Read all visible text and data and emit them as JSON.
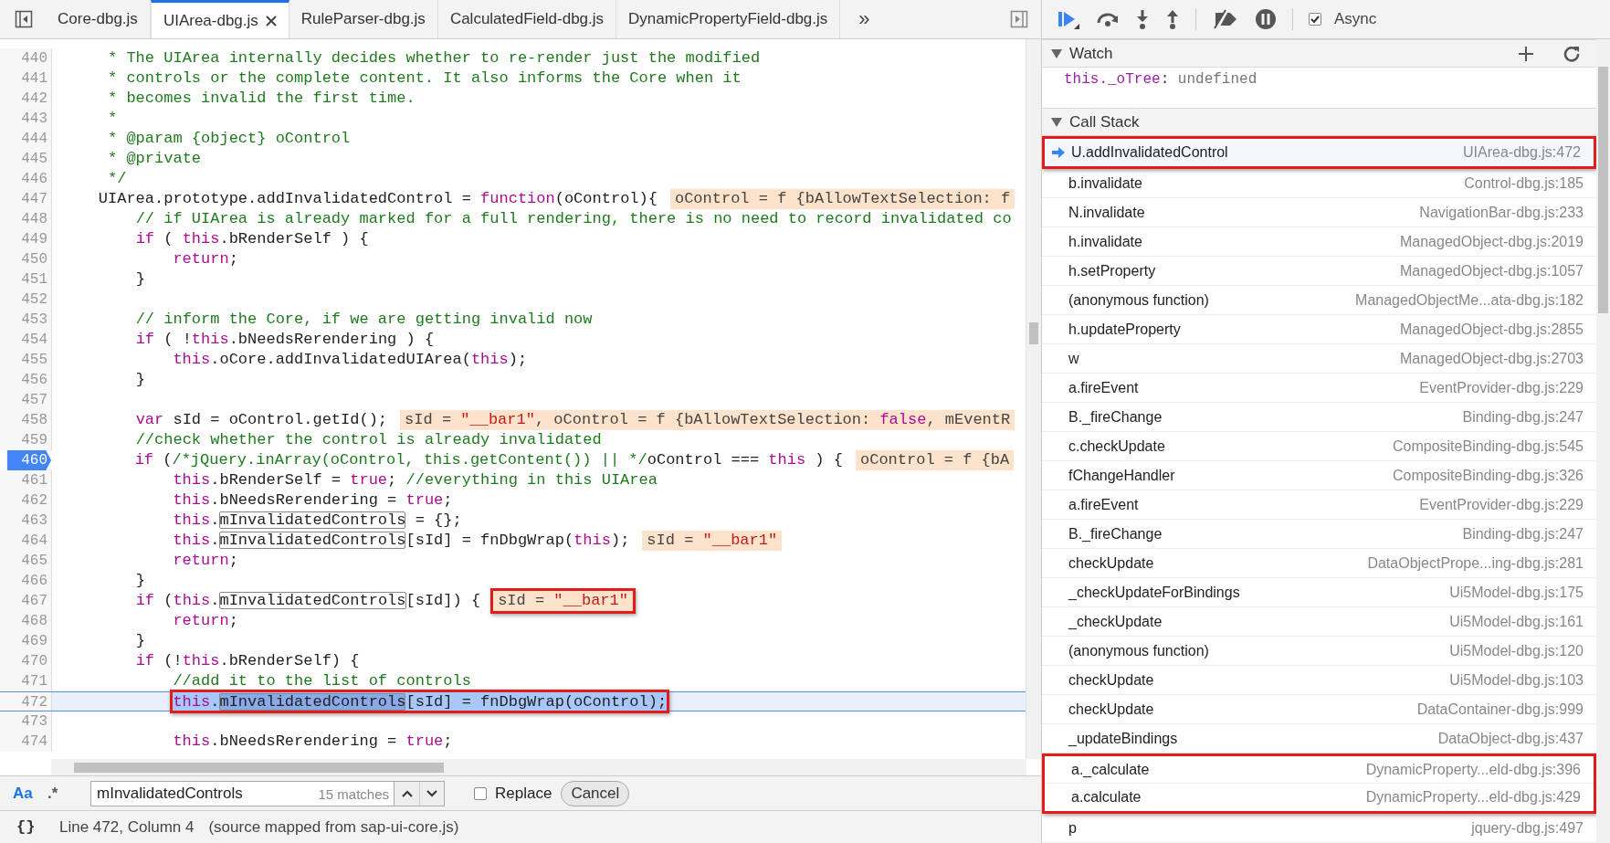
{
  "editor": {
    "tabs": [
      {
        "label": "Core-dbg.js",
        "selected": false
      },
      {
        "label": "UIArea-dbg.js",
        "selected": true
      },
      {
        "label": "RuleParser-dbg.js",
        "selected": false
      },
      {
        "label": "CalculatedField-dbg.js",
        "selected": false
      },
      {
        "label": "DynamicPropertyField-dbg.js",
        "selected": false
      }
    ],
    "more_tabs": "»",
    "lines": [
      {
        "number": "440",
        "breakpoint": false,
        "current": false,
        "code": [
          {
            "kind": "comment",
            "text": "     * The UIArea internally decides whether to re-render just the modified"
          }
        ]
      },
      {
        "number": "441",
        "breakpoint": false,
        "current": false,
        "code": [
          {
            "kind": "comment",
            "text": "     * controls or the complete content. It also informs the Core when it"
          }
        ]
      },
      {
        "number": "442",
        "breakpoint": false,
        "current": false,
        "code": [
          {
            "kind": "comment",
            "text": "     * becomes invalid the first time."
          }
        ]
      },
      {
        "number": "443",
        "breakpoint": false,
        "current": false,
        "code": [
          {
            "kind": "comment",
            "text": "     *"
          }
        ]
      },
      {
        "number": "444",
        "breakpoint": false,
        "current": false,
        "code": [
          {
            "kind": "comment",
            "text": "     * @param {object} oControl"
          }
        ]
      },
      {
        "number": "445",
        "breakpoint": false,
        "current": false,
        "code": [
          {
            "kind": "comment",
            "text": "     * @private"
          }
        ]
      },
      {
        "number": "446",
        "breakpoint": false,
        "current": false,
        "code": [
          {
            "kind": "comment",
            "text": "     */"
          }
        ]
      },
      {
        "number": "447",
        "breakpoint": false,
        "current": false,
        "code": [
          "    UIArea.prototype.addInvalidatedControl = ",
          {
            "kind": "keyword",
            "text": "function"
          },
          "(oControl){"
        ],
        "value": [
          "oControl = f {bAllowTextSelection: f"
        ]
      },
      {
        "number": "448",
        "breakpoint": false,
        "current": false,
        "code": [
          {
            "kind": "comment",
            "text": "        // if UIArea is already marked for a full rendering, there is no need to record invalidated co"
          }
        ]
      },
      {
        "number": "449",
        "breakpoint": false,
        "current": false,
        "code": [
          {
            "kind": "keyword",
            "text": "        if"
          },
          " ( ",
          {
            "kind": "keyword",
            "text": "this"
          },
          ".bRenderSelf ) {"
        ]
      },
      {
        "number": "450",
        "breakpoint": false,
        "current": false,
        "code": [
          {
            "kind": "keyword",
            "text": "            return"
          },
          ";"
        ]
      },
      {
        "number": "451",
        "breakpoint": false,
        "current": false,
        "code": [
          "        }"
        ]
      },
      {
        "number": "452",
        "breakpoint": false,
        "current": false
      },
      {
        "number": "453",
        "breakpoint": false,
        "current": false,
        "code": [
          {
            "kind": "comment",
            "text": "        // inform the Core, if we are getting invalid now"
          }
        ]
      },
      {
        "number": "454",
        "breakpoint": false,
        "current": false,
        "code": [
          {
            "kind": "keyword",
            "text": "        if"
          },
          " ( !",
          {
            "kind": "keyword",
            "text": "this"
          },
          ".bNeedsRerendering ) {"
        ]
      },
      {
        "number": "455",
        "breakpoint": false,
        "current": false,
        "code": [
          {
            "kind": "keyword",
            "text": "            this"
          },
          ".oCore.addInvalidatedUIArea(",
          {
            "kind": "keyword",
            "text": "this"
          },
          ");"
        ]
      },
      {
        "number": "456",
        "breakpoint": false,
        "current": false,
        "code": [
          "        }"
        ]
      },
      {
        "number": "457",
        "breakpoint": false,
        "current": false
      },
      {
        "number": "458",
        "breakpoint": false,
        "current": false,
        "code": [
          {
            "kind": "keyword",
            "text": "        var"
          },
          " sId = oControl.getId();"
        ],
        "value": [
          "sId = ",
          {
            "kind": "string",
            "text": "\"__bar1\""
          },
          ", oControl = f {bAllowTextSelection: ",
          {
            "kind": "keyword",
            "text": "false"
          },
          ", mEventR"
        ]
      },
      {
        "number": "459",
        "breakpoint": false,
        "current": false,
        "code": [
          {
            "kind": "comment",
            "text": "        //check whether the control is already invalidated"
          }
        ]
      },
      {
        "number": "460",
        "breakpoint": true,
        "current": false,
        "code": [
          {
            "kind": "keyword",
            "text": "        if"
          },
          " (",
          {
            "kind": "comment",
            "text": "/*jQuery.inArray(oControl, this.getContent()) || */"
          },
          "oControl === ",
          {
            "kind": "keyword",
            "text": "this"
          },
          " ) {"
        ],
        "value": [
          "oControl = f {bA"
        ]
      },
      {
        "number": "461",
        "breakpoint": false,
        "current": false,
        "code": [
          {
            "kind": "keyword",
            "text": "            this"
          },
          ".bRenderSelf = ",
          {
            "kind": "keyword",
            "text": "true"
          },
          "; ",
          {
            "kind": "comment",
            "text": "//everything in this UIArea"
          }
        ]
      },
      {
        "number": "462",
        "breakpoint": false,
        "current": false,
        "code": [
          {
            "kind": "keyword",
            "text": "            this"
          },
          ".bNeedsRerendering = ",
          {
            "kind": "keyword",
            "text": "true"
          },
          ";"
        ]
      },
      {
        "number": "463",
        "breakpoint": false,
        "current": false,
        "code": [
          {
            "kind": "keyword",
            "text": "            this"
          },
          ".",
          {
            "kind": "match",
            "text": "mInvalidatedControls"
          },
          " = {};"
        ]
      },
      {
        "number": "464",
        "breakpoint": false,
        "current": false,
        "code": [
          {
            "kind": "keyword",
            "text": "            this"
          },
          ".",
          {
            "kind": "match",
            "text": "mInvalidatedControls"
          },
          "[sId] = fnDbgWrap(",
          {
            "kind": "keyword",
            "text": "this"
          },
          ");"
        ],
        "value": [
          "sId = ",
          {
            "kind": "string",
            "text": "\"__bar1\""
          }
        ]
      },
      {
        "number": "465",
        "breakpoint": false,
        "current": false,
        "code": [
          {
            "kind": "keyword",
            "text": "            return"
          },
          ";"
        ]
      },
      {
        "number": "466",
        "breakpoint": false,
        "current": false,
        "code": [
          "        }"
        ]
      },
      {
        "number": "467",
        "breakpoint": false,
        "current": false,
        "code": [
          {
            "kind": "keyword",
            "text": "        if"
          },
          " (",
          {
            "kind": "keyword",
            "text": "this"
          },
          ".",
          {
            "kind": "match",
            "text": "mInvalidatedControls"
          },
          "[sId]) {"
        ],
        "value": [
          "sId = ",
          {
            "kind": "string",
            "text": "\"__bar1\""
          }
        ],
        "value_marked": true
      },
      {
        "number": "468",
        "breakpoint": false,
        "current": false,
        "code": [
          {
            "kind": "keyword",
            "text": "            return"
          },
          ";"
        ]
      },
      {
        "number": "469",
        "breakpoint": false,
        "current": false,
        "code": [
          "        }"
        ]
      },
      {
        "number": "470",
        "breakpoint": false,
        "current": false,
        "code": [
          {
            "kind": "keyword",
            "text": "        if"
          },
          " (!",
          {
            "kind": "keyword",
            "text": "this"
          },
          ".bRenderSelf) {"
        ]
      },
      {
        "number": "471",
        "breakpoint": false,
        "current": false,
        "code": [
          {
            "kind": "comment",
            "text": "            //add it to the list of controls"
          }
        ]
      },
      {
        "number": "472",
        "breakpoint": false,
        "current": true,
        "code": [
          {
            "kind": "keyword",
            "text": "            this"
          },
          ".",
          {
            "kind": "match",
            "text": "mInvalidatedControls"
          },
          "[sId] = fnDbgWrap(oControl);"
        ],
        "code_marked": true
      },
      {
        "number": "473",
        "breakpoint": false,
        "current": false
      },
      {
        "number": "474",
        "breakpoint": false,
        "current": false,
        "code": [
          {
            "kind": "keyword",
            "text": "            this"
          },
          ".bNeedsRerendering = ",
          {
            "kind": "keyword",
            "text": "true"
          },
          ";"
        ]
      }
    ],
    "search": {
      "case_label": "Aa",
      "case_on": true,
      "regex_label": ".*",
      "regex_on": false,
      "value": "mInvalidatedControls",
      "matches": "15 matches",
      "replace": {
        "label": "Replace",
        "checked": false
      },
      "cancel": "Cancel"
    },
    "status": {
      "format_icon": "{}",
      "position": "Line 472, Column 4",
      "source": "(source mapped from sap-ui-core.js)"
    }
  },
  "debugger": {
    "toolbar": [
      {
        "kind": "resume"
      },
      {
        "kind": "step-over"
      },
      {
        "kind": "step-into"
      },
      {
        "kind": "step-out"
      },
      {
        "kind": "separator"
      },
      {
        "kind": "deactivate"
      },
      {
        "kind": "pause"
      },
      {
        "kind": "separator"
      }
    ],
    "async": {
      "label": "Async",
      "checked": true
    },
    "watch": {
      "title": "Watch",
      "expanded": true,
      "items": [
        {
          "name": "this._oTree",
          "separator": ":",
          "value": "undefined"
        }
      ]
    },
    "call_stack": {
      "title": "Call Stack",
      "expanded": true,
      "frames": [
        {
          "function": "U.addInvalidatedControl",
          "location": "UIArea-dbg.js:472",
          "selected": true,
          "marked": true
        },
        {
          "function": "b.invalidate",
          "location": "Control-dbg.js:185",
          "selected": false
        },
        {
          "function": "N.invalidate",
          "location": "NavigationBar-dbg.js:233",
          "selected": false
        },
        {
          "function": "h.invalidate",
          "location": "ManagedObject-dbg.js:2019",
          "selected": false
        },
        {
          "function": "h.setProperty",
          "location": "ManagedObject-dbg.js:1057",
          "selected": false
        },
        {
          "function": "(anonymous function)",
          "location": "ManagedObjectMe...ata-dbg.js:182",
          "selected": false
        },
        {
          "function": "h.updateProperty",
          "location": "ManagedObject-dbg.js:2855",
          "selected": false
        },
        {
          "function": "w",
          "location": "ManagedObject-dbg.js:2703",
          "selected": false
        },
        {
          "function": "a.fireEvent",
          "location": "EventProvider-dbg.js:229",
          "selected": false
        },
        {
          "function": "B._fireChange",
          "location": "Binding-dbg.js:247",
          "selected": false
        },
        {
          "function": "c.checkUpdate",
          "location": "CompositeBinding-dbg.js:545",
          "selected": false
        },
        {
          "function": "fChangeHandler",
          "location": "CompositeBinding-dbg.js:326",
          "selected": false
        },
        {
          "function": "a.fireEvent",
          "location": "EventProvider-dbg.js:229",
          "selected": false
        },
        {
          "function": "B._fireChange",
          "location": "Binding-dbg.js:247",
          "selected": false
        },
        {
          "function": "checkUpdate",
          "location": "DataObjectPrope...ing-dbg.js:281",
          "selected": false
        },
        {
          "function": "_checkUpdateForBindings",
          "location": "Ui5Model-dbg.js:175",
          "selected": false
        },
        {
          "function": "_checkUpdate",
          "location": "Ui5Model-dbg.js:161",
          "selected": false
        },
        {
          "function": "(anonymous function)",
          "location": "Ui5Model-dbg.js:120",
          "selected": false
        },
        {
          "function": "checkUpdate",
          "location": "Ui5Model-dbg.js:103",
          "selected": false
        },
        {
          "function": "checkUpdate",
          "location": "DataContainer-dbg.js:999",
          "selected": false
        },
        {
          "function": "_updateBindings",
          "location": "DataObject-dbg.js:437",
          "selected": false
        },
        {
          "function": "a._calculate",
          "location": "DynamicProperty...eld-dbg.js:396",
          "selected": false,
          "marked": true
        },
        {
          "function": "a.calculate",
          "location": "DynamicProperty...eld-dbg.js:429",
          "selected": false,
          "marked": true
        },
        {
          "function": "p",
          "location": "jquery-dbg.js:497",
          "selected": false
        }
      ]
    }
  }
}
